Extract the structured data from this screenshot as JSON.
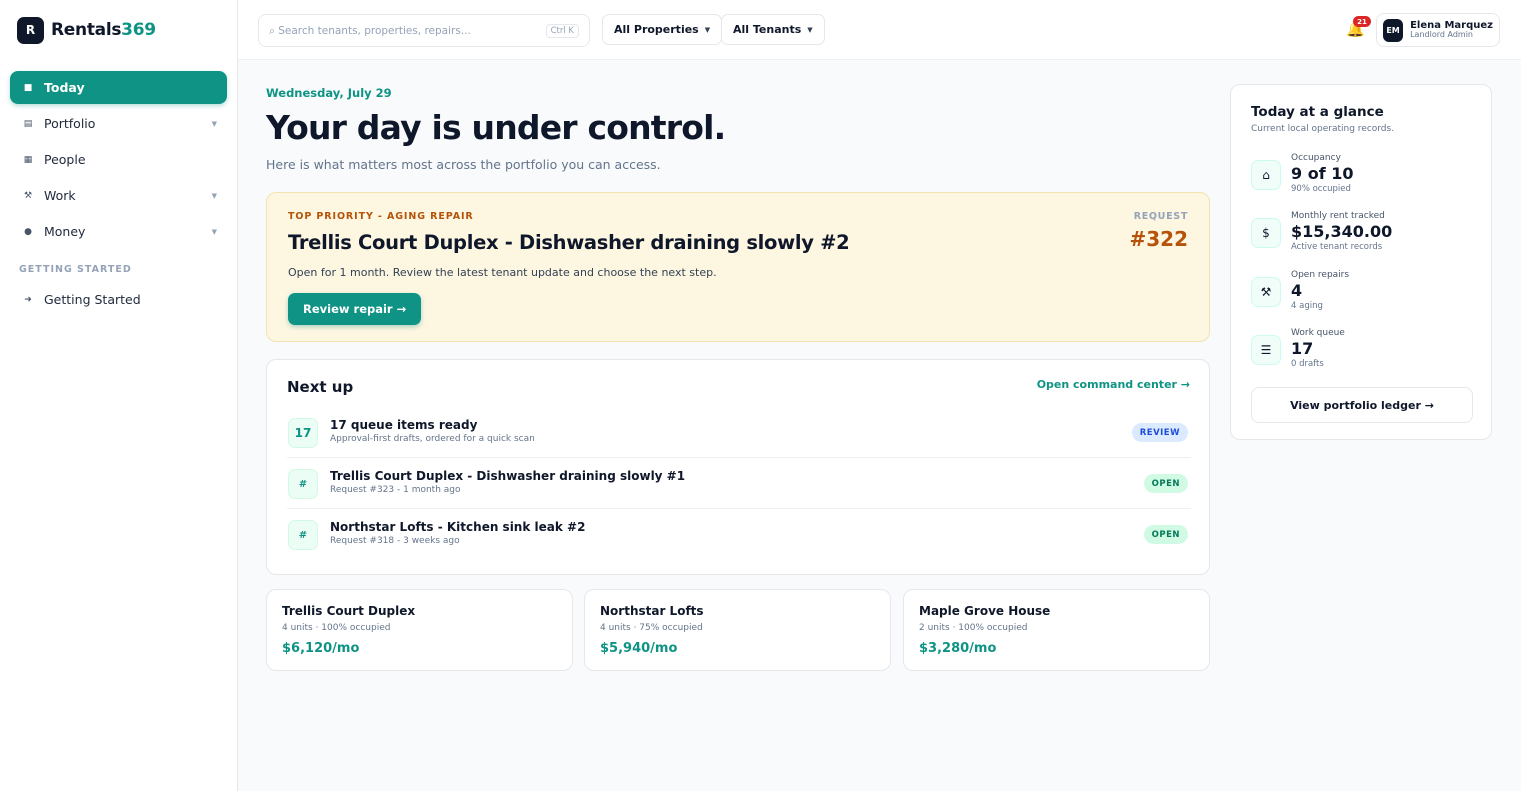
{
  "brand": {
    "logo_letter": "R",
    "name_primary": "Rentals",
    "name_accent": "369",
    "accent_color": "#0e9384"
  },
  "sidebar": {
    "items": [
      {
        "label": "Today",
        "icon": "square-icon",
        "glyph": "■",
        "active": true,
        "caret": false
      },
      {
        "label": "Portfolio",
        "icon": "list-icon",
        "glyph": "▤",
        "active": false,
        "caret": true
      },
      {
        "label": "People",
        "icon": "people-icon",
        "glyph": "▦",
        "active": false,
        "caret": false
      },
      {
        "label": "Work",
        "icon": "tools-icon",
        "glyph": "⚒",
        "active": false,
        "caret": true
      },
      {
        "label": "Money",
        "icon": "coin-icon",
        "glyph": "●",
        "active": false,
        "caret": true
      }
    ],
    "section_label": "GETTING STARTED",
    "getting_started": {
      "label": "Getting Started",
      "glyph": "➜"
    }
  },
  "topbar": {
    "search_placeholder": "⌕ Search tenants, properties, repairs...",
    "search_shortcut": "Ctrl K",
    "filter_properties": "All Properties",
    "filter_tenants": "All Tenants",
    "notification_count": "21",
    "user": {
      "initials": "EM",
      "name": "Elena Marquez",
      "role": "Landlord Admin"
    }
  },
  "main": {
    "date": "Wednesday, July 29",
    "headline": "Your day is under control.",
    "subhead": "Here is what matters most across the portfolio you can access.",
    "priority": {
      "kicker": "TOP PRIORITY - AGING REPAIR",
      "title": "Trellis Court Duplex - Dishwasher draining slowly #2",
      "description": "Open for 1 month. Review the latest tenant update and choose the next step.",
      "button": "Review repair →",
      "request_label": "REQUEST",
      "request_number": "#322"
    },
    "next_up": {
      "title": "Next up",
      "link": "Open command center →",
      "rows": [
        {
          "icon_text": "17",
          "title": "17 queue items ready",
          "sub": "Approval-first drafts, ordered for a quick scan",
          "status": "REVIEW",
          "status_kind": "review"
        },
        {
          "icon_text": "#",
          "title": "Trellis Court Duplex - Dishwasher draining slowly #1",
          "sub": "Request #323 - 1 month ago",
          "status": "OPEN",
          "status_kind": "open"
        },
        {
          "icon_text": "#",
          "title": "Northstar Lofts - Kitchen sink leak #2",
          "sub": "Request #318 - 3 weeks ago",
          "status": "OPEN",
          "status_kind": "open"
        }
      ]
    },
    "properties": [
      {
        "name": "Trellis Court Duplex",
        "meta": "4 units · 100% occupied",
        "rent": "$6,120/mo"
      },
      {
        "name": "Northstar Lofts",
        "meta": "4 units · 75% occupied",
        "rent": "$5,940/mo"
      },
      {
        "name": "Maple Grove House",
        "meta": "2 units · 100% occupied",
        "rent": "$3,280/mo"
      }
    ]
  },
  "glance": {
    "title": "Today at a glance",
    "subtitle": "Current local operating records.",
    "stats": [
      {
        "icon": "home-icon",
        "glyph": "⌂",
        "label": "Occupancy",
        "value": "9 of 10",
        "note": "90% occupied"
      },
      {
        "icon": "dollar-icon",
        "glyph": "$",
        "label": "Monthly rent tracked",
        "value": "$15,340.00",
        "note": "Active tenant records"
      },
      {
        "icon": "tools-icon",
        "glyph": "⚒",
        "label": "Open repairs",
        "value": "4",
        "note": "4 aging"
      },
      {
        "icon": "queue-icon",
        "glyph": "☰",
        "label": "Work queue",
        "value": "17",
        "note": "0 drafts"
      }
    ],
    "ledger_button": "View portfolio ledger →"
  }
}
